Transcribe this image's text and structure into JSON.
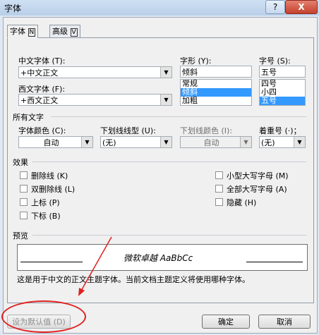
{
  "window": {
    "title": "字体",
    "help_label": "?",
    "close_label": "X"
  },
  "tabs": [
    {
      "label": "字体",
      "key": "N"
    },
    {
      "label": "高级",
      "key": "V"
    }
  ],
  "chinese_font": {
    "label": "中文字体 (T):",
    "value": "+中文正文"
  },
  "western_font": {
    "label": "西文字体 (F):",
    "value": "+西文正文"
  },
  "style": {
    "label": "字形 (Y):",
    "value": "倾斜",
    "options": [
      "常规",
      "倾斜",
      "加粗"
    ],
    "selected_index": 1
  },
  "size": {
    "label": "字号 (S):",
    "value": "五号",
    "options": [
      "四号",
      "小四",
      "五号"
    ],
    "selected_index": 2
  },
  "all_text": {
    "section": "所有文字",
    "font_color": {
      "label": "字体颜色 (C):",
      "value": "自动"
    },
    "underline_style": {
      "label": "下划线线型 (U):",
      "value": "(无)"
    },
    "underline_color": {
      "label": "下划线颜色 (I):",
      "value": "自动"
    },
    "emphasis": {
      "label": "着重号 (·)；",
      "value": "(无)"
    }
  },
  "effects": {
    "section": "效果",
    "left": [
      "删除线 (K)",
      "双删除线 (L)",
      "上标 (P)",
      "下标 (B)"
    ],
    "right": [
      "小型大写字母 (M)",
      "全部大写字母 (A)",
      "隐藏 (H)"
    ]
  },
  "preview": {
    "section": "预览",
    "sample": "微软卓越 AaBbCc",
    "description": "这是用于中文的正文主题字体。当前文档主题定义将使用哪种字体。"
  },
  "buttons": {
    "set_default": "设为默认值 (D)",
    "ok": "确定",
    "cancel": "取消"
  },
  "annotation_color": "#e02020"
}
